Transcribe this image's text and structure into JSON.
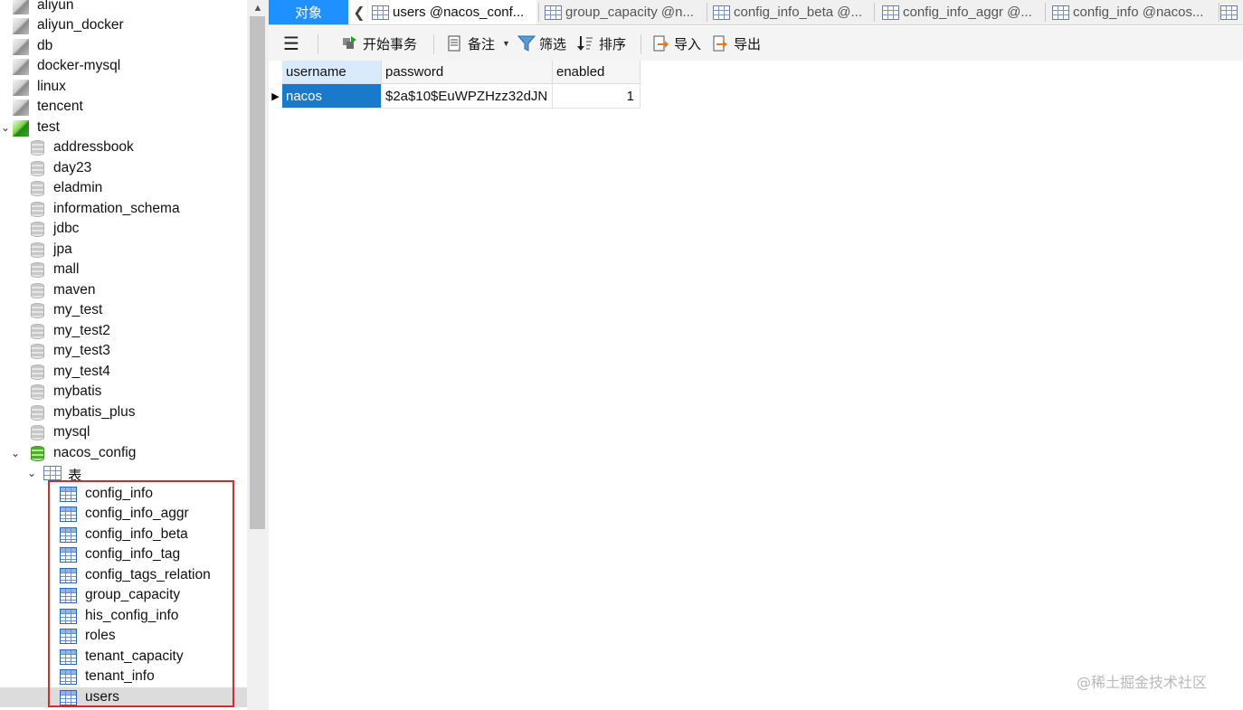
{
  "tree": {
    "connections": [
      {
        "label": "aliyun"
      },
      {
        "label": "aliyun_docker"
      },
      {
        "label": "db"
      },
      {
        "label": "docker-mysql"
      },
      {
        "label": "linux"
      },
      {
        "label": "tencent"
      },
      {
        "label": "test",
        "expanded": true
      }
    ],
    "databases": [
      {
        "label": "addressbook"
      },
      {
        "label": "day23"
      },
      {
        "label": "eladmin"
      },
      {
        "label": "information_schema"
      },
      {
        "label": "jdbc"
      },
      {
        "label": "jpa"
      },
      {
        "label": "mall"
      },
      {
        "label": "maven"
      },
      {
        "label": "my_test"
      },
      {
        "label": "my_test2"
      },
      {
        "label": "my_test3"
      },
      {
        "label": "my_test4"
      },
      {
        "label": "mybatis"
      },
      {
        "label": "mybatis_plus"
      },
      {
        "label": "mysql"
      },
      {
        "label": "nacos_config",
        "expanded": true
      }
    ],
    "tables_folder": {
      "label": "表"
    },
    "tables": [
      {
        "label": "config_info"
      },
      {
        "label": "config_info_aggr"
      },
      {
        "label": "config_info_beta"
      },
      {
        "label": "config_info_tag"
      },
      {
        "label": "config_tags_relation"
      },
      {
        "label": "group_capacity"
      },
      {
        "label": "his_config_info"
      },
      {
        "label": "roles"
      },
      {
        "label": "tenant_capacity"
      },
      {
        "label": "tenant_info"
      },
      {
        "label": "users",
        "selected": true
      }
    ],
    "highlight_color": "#d12b2b"
  },
  "tabs": {
    "objects_label": "对象",
    "items": [
      {
        "label": "users @nacos_conf...",
        "active": true
      },
      {
        "label": "group_capacity @n..."
      },
      {
        "label": "config_info_beta @..."
      },
      {
        "label": "config_info_aggr @..."
      },
      {
        "label": "config_info @nacos..."
      }
    ]
  },
  "toolbar": {
    "menu_icon": "hamburger-icon",
    "begin_transaction": "开始事务",
    "memo": "备注",
    "filter": "筛选",
    "sort": "排序",
    "import": "导入",
    "export": "导出"
  },
  "grid": {
    "columns": [
      "username",
      "password",
      "enabled"
    ],
    "rows": [
      {
        "username": "nacos",
        "password": "$2a$10$EuWPZHzz32dJN",
        "enabled": "1"
      }
    ],
    "selection_color": "#1979ca"
  },
  "watermark": "@稀土掘金技术社区"
}
